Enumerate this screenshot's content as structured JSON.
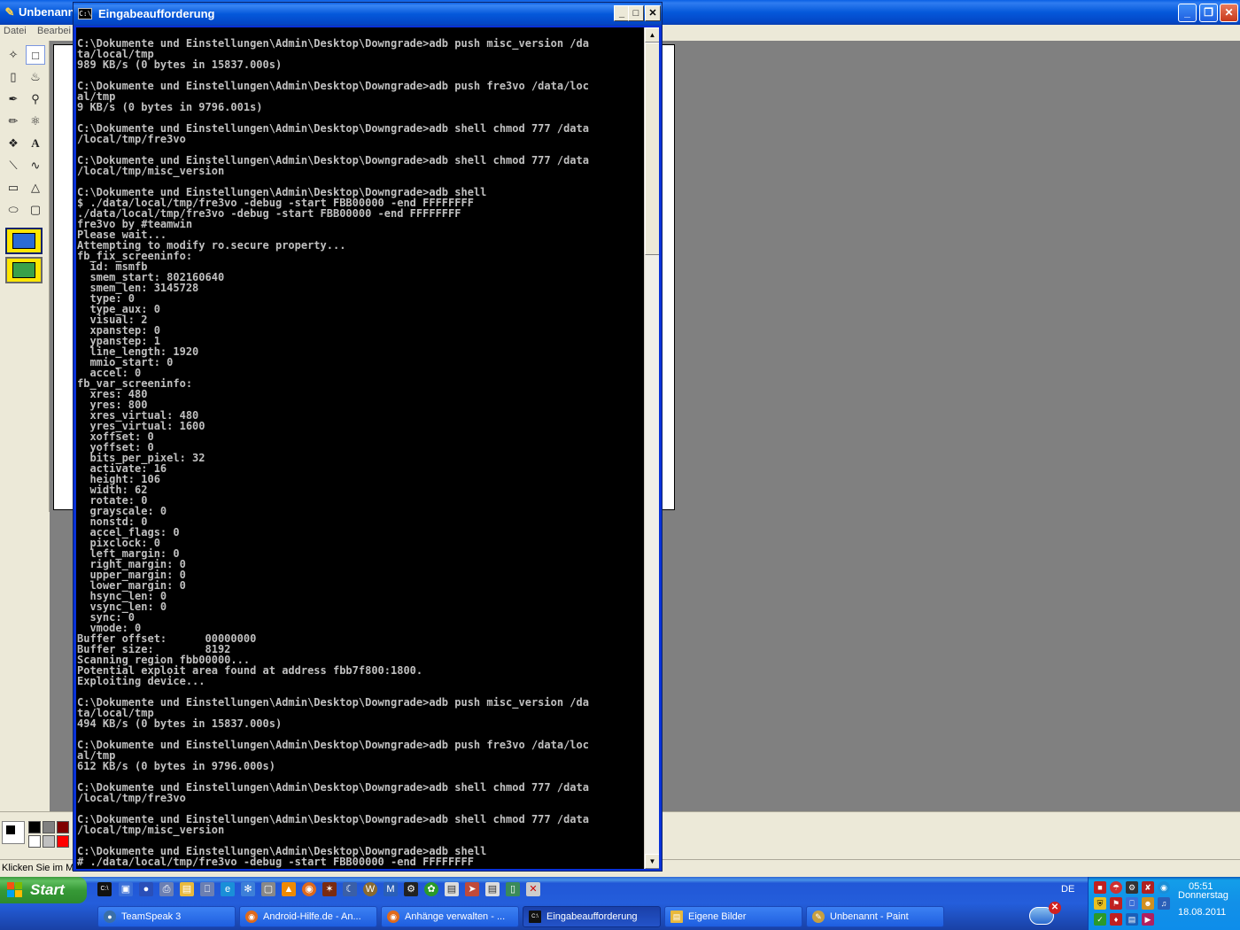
{
  "paint": {
    "title": "Unbenannt",
    "menu": [
      "Datei",
      "Bearbei"
    ],
    "status_text": "Klicken Sie im Me",
    "palette_colors": [
      "#000000",
      "#808080",
      "#800000",
      "#ffffff",
      "#c0c0c0",
      "#ff0000"
    ]
  },
  "cmd": {
    "title": "Eingabeaufforderung",
    "icon_text": "C:\\",
    "output": "C:\\Dokumente und Einstellungen\\Admin\\Desktop\\Downgrade>adb push misc_version /da\nta/local/tmp\n989 KB/s (0 bytes in 15837.000s)\n\nC:\\Dokumente und Einstellungen\\Admin\\Desktop\\Downgrade>adb push fre3vo /data/loc\nal/tmp\n9 KB/s (0 bytes in 9796.001s)\n\nC:\\Dokumente und Einstellungen\\Admin\\Desktop\\Downgrade>adb shell chmod 777 /data\n/local/tmp/fre3vo\n\nC:\\Dokumente und Einstellungen\\Admin\\Desktop\\Downgrade>adb shell chmod 777 /data\n/local/tmp/misc_version\n\nC:\\Dokumente und Einstellungen\\Admin\\Desktop\\Downgrade>adb shell\n$ ./data/local/tmp/fre3vo -debug -start FBB00000 -end FFFFFFFF\n./data/local/tmp/fre3vo -debug -start FBB00000 -end FFFFFFFF\nfre3vo by #teamwin\nPlease wait...\nAttempting to modify ro.secure property...\nfb_fix_screeninfo:\n  id: msmfb\n  smem_start: 802160640\n  smem_len: 3145728\n  type: 0\n  type_aux: 0\n  visual: 2\n  xpanstep: 0\n  ypanstep: 1\n  line_length: 1920\n  mmio_start: 0\n  accel: 0\nfb_var_screeninfo:\n  xres: 480\n  yres: 800\n  xres_virtual: 480\n  yres_virtual: 1600\n  xoffset: 0\n  yoffset: 0\n  bits_per_pixel: 32\n  activate: 16\n  height: 106\n  width: 62\n  rotate: 0\n  grayscale: 0\n  nonstd: 0\n  accel_flags: 0\n  pixclock: 0\n  left_margin: 0\n  right_margin: 0\n  upper_margin: 0\n  lower_margin: 0\n  hsync_len: 0\n  vsync_len: 0\n  sync: 0\n  vmode: 0\nBuffer offset:      00000000\nBuffer size:        8192\nScanning region fbb00000...\nPotential exploit area found at address fbb7f800:1800.\nExploiting device...\n\nC:\\Dokumente und Einstellungen\\Admin\\Desktop\\Downgrade>adb push misc_version /da\nta/local/tmp\n494 KB/s (0 bytes in 15837.000s)\n\nC:\\Dokumente und Einstellungen\\Admin\\Desktop\\Downgrade>adb push fre3vo /data/loc\nal/tmp\n612 KB/s (0 bytes in 9796.000s)\n\nC:\\Dokumente und Einstellungen\\Admin\\Desktop\\Downgrade>adb shell chmod 777 /data\n/local/tmp/fre3vo\n\nC:\\Dokumente und Einstellungen\\Admin\\Desktop\\Downgrade>adb shell chmod 777 /data\n/local/tmp/misc_version\n\nC:\\Dokumente und Einstellungen\\Admin\\Desktop\\Downgrade>adb shell\n# ./data/local/tmp/fre3vo -debug -start FBB00000 -end FFFFFFFF"
  },
  "taskbar": {
    "start_label": "Start",
    "language": "DE",
    "tasks": [
      {
        "label": "TeamSpeak 3",
        "icon": "teamspeak-icon",
        "active": false
      },
      {
        "label": "Android-Hilfe.de - An...",
        "icon": "firefox-icon",
        "active": false
      },
      {
        "label": "Anhänge verwalten - ...",
        "icon": "firefox-icon",
        "active": false
      },
      {
        "label": "Eingabeaufforderung",
        "icon": "cmd-icon",
        "active": true
      },
      {
        "label": "Eigene Bilder",
        "icon": "folder-icon",
        "active": false
      },
      {
        "label": "Unbenannt - Paint",
        "icon": "paint-icon",
        "active": false
      }
    ],
    "clock": {
      "time": "05:51",
      "day": "Donnerstag",
      "date": "18.08.2011"
    }
  }
}
